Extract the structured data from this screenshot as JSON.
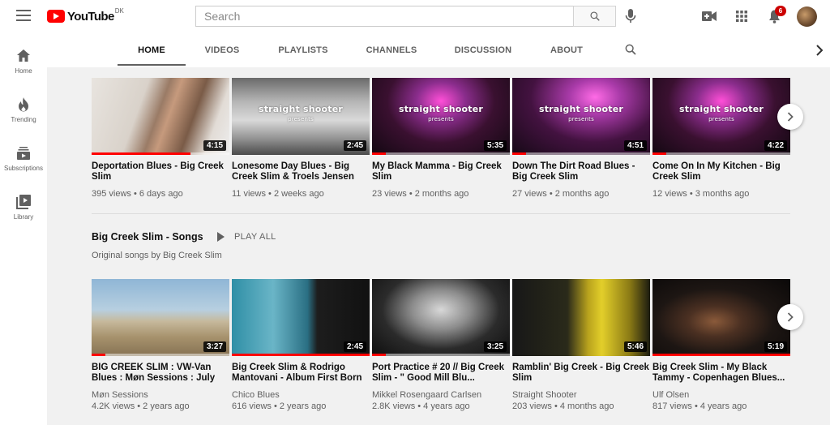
{
  "header": {
    "logo_text": "YouTube",
    "country_code": "DK",
    "search_placeholder": "Search",
    "notification_count": "6",
    "colors": {
      "brand": "#ff0000",
      "badge": "#cc0000"
    }
  },
  "guide": {
    "items": [
      {
        "label": "Home",
        "icon": "home-icon"
      },
      {
        "label": "Trending",
        "icon": "trending-icon"
      },
      {
        "label": "Subscriptions",
        "icon": "subscriptions-icon"
      },
      {
        "label": "Library",
        "icon": "library-icon"
      }
    ]
  },
  "tabs": [
    {
      "label": "HOME",
      "active": true
    },
    {
      "label": "VIDEOS"
    },
    {
      "label": "PLAYLISTS"
    },
    {
      "label": "CHANNELS"
    },
    {
      "label": "DISCUSSION"
    },
    {
      "label": "ABOUT"
    }
  ],
  "uploads": [
    {
      "title": "Deportation Blues - Big Creek Slim",
      "meta": "395 views • 6 days ago",
      "duration": "4:15",
      "watched": 0.72
    },
    {
      "title": "Lonesome Day Blues - Big Creek Slim & Troels Jensen",
      "meta": "11 views • 2 weeks ago",
      "duration": "2:45",
      "watched": 0
    },
    {
      "title": "My Black Mamma - Big Creek Slim",
      "meta": "23 views • 2 months ago",
      "duration": "5:35",
      "watched": 0.1
    },
    {
      "title": "Down The Dirt Road Blues - Big Creek Slim",
      "meta": "27 views • 2 months ago",
      "duration": "4:51",
      "watched": 0.1
    },
    {
      "title": "Come On In My Kitchen - Big Creek Slim",
      "meta": "12 views • 3 months ago",
      "duration": "4:22",
      "watched": 0.1
    }
  ],
  "songs_shelf": {
    "title": "Big Creek Slim - Songs",
    "play_all": "PLAY ALL",
    "description": "Original songs by Big Creek Slim",
    "videos": [
      {
        "title": "BIG CREEK SLIM : VW-Van Blues : Møn Sessions : July",
        "channel": "Møn Sessions",
        "meta": "4.2K views • 2 years ago",
        "duration": "3:27",
        "watched": 0.1
      },
      {
        "title": "Big Creek Slim & Rodrigo Mantovani - Album First Born",
        "channel": "Chico Blues",
        "meta": "616 views • 2 years ago",
        "duration": "2:45",
        "watched": 1.0
      },
      {
        "title": "Port Practice # 20 // Big Creek Slim - \" Good Mill Blu...",
        "channel": "Mikkel Rosengaard Carlsen",
        "meta": "2.8K views • 4 years ago",
        "duration": "3:25",
        "watched": 0.1
      },
      {
        "title": "Ramblin' Big Creek - Big Creek Slim",
        "channel": "Straight Shooter",
        "meta": "203 views • 4 months ago",
        "duration": "5:46",
        "watched": 0
      },
      {
        "title": "Big Creek Slim - My Black Tammy - Copenhagen Blues...",
        "channel": "Ulf Olsen",
        "meta": "817 views • 4 years ago",
        "duration": "5:19",
        "watched": 1.0
      }
    ]
  },
  "thumb_text": {
    "brand": "straight shooter",
    "presents": "presents"
  }
}
